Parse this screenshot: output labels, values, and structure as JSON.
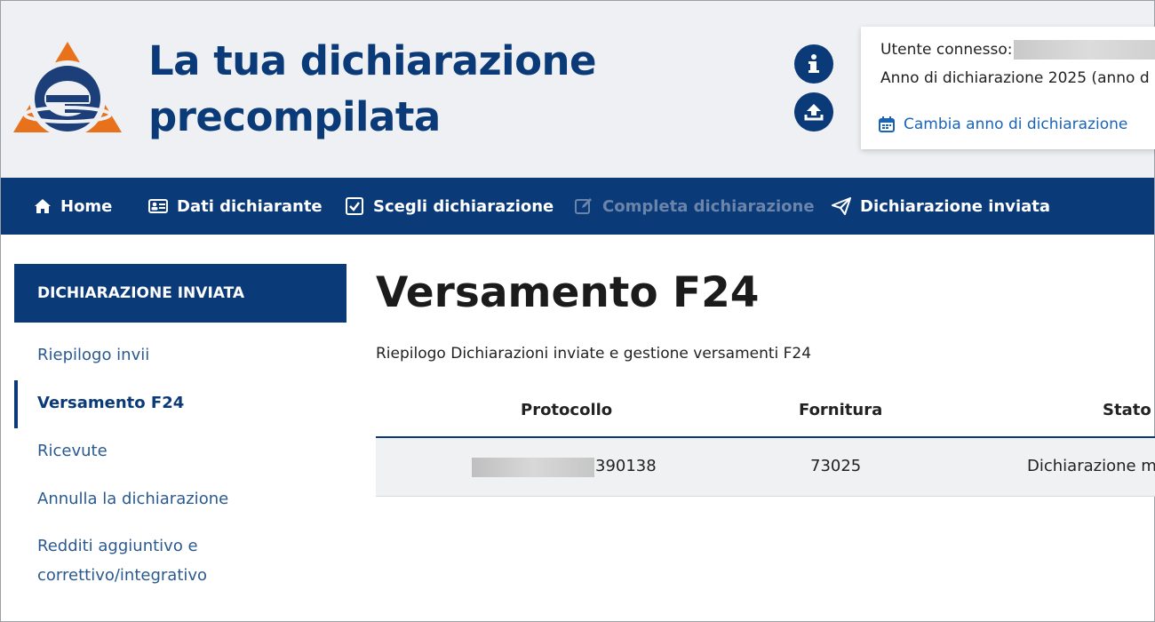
{
  "header": {
    "app_title_line1": "La tua dichiarazione",
    "app_title_line2": "precompilata",
    "user": {
      "connected_label": "Utente connesso:",
      "year_text": "Anno di dichiarazione 2025 (anno d",
      "change_year_label": "Cambia anno di dichiarazione"
    }
  },
  "nav": {
    "items": [
      {
        "label": "Home",
        "icon": "home-icon"
      },
      {
        "label": "Dati dichiarante",
        "icon": "id-card-icon"
      },
      {
        "label": "Scegli dichiarazione",
        "icon": "checkbox-icon"
      },
      {
        "label": "Completa dichiarazione",
        "icon": "edit-icon",
        "disabled": true
      },
      {
        "label": "Dichiarazione inviata",
        "icon": "paper-plane-icon"
      }
    ]
  },
  "sidebar": {
    "heading": "DICHIARAZIONE INVIATA",
    "items": [
      {
        "label": "Riepilogo invii"
      },
      {
        "label": "Versamento F24",
        "active": true
      },
      {
        "label": "Ricevute"
      },
      {
        "label": "Annulla la dichiarazione"
      },
      {
        "label": "Redditi aggiuntivo e correttivo/integrativo"
      }
    ]
  },
  "main": {
    "title": "Versamento F24",
    "subtitle": "Riepilogo Dichiarazioni inviate e gestione versamenti F24",
    "table": {
      "columns": [
        "Protocollo",
        "Fornitura",
        "Stato"
      ],
      "rows": [
        {
          "protocollo_visible": "390138",
          "fornitura": "73025",
          "stato": "Dichiarazione m"
        }
      ]
    }
  },
  "colors": {
    "primary": "#0b3a78",
    "link": "#1a64b8",
    "header_bg": "#eef0f3",
    "logo_orange": "#e8711c"
  }
}
